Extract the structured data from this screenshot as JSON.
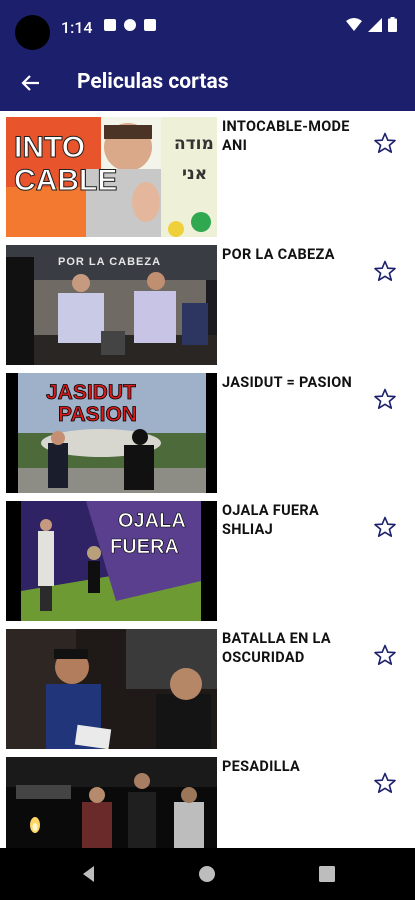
{
  "status_bar": {
    "time": "1:14"
  },
  "app_bar": {
    "title": "Peliculas cortas",
    "back_icon": "arrow-back-icon"
  },
  "items": [
    {
      "title": "INTOCABLE-MODE ANI",
      "thumb_lines": [
        "INTO",
        "CABLE"
      ],
      "thumb_hebrew": [
        "מודה",
        "אני"
      ]
    },
    {
      "title": "POR LA CABEZA",
      "thumb_lines": [
        "POR LA CABEZA"
      ]
    },
    {
      "title": "JASIDUT = PASION",
      "thumb_lines": [
        "JASIDUT",
        "PASION"
      ]
    },
    {
      "title": "OJALA FUERA SHLIAJ",
      "thumb_lines": [
        "OJALA",
        "FUERA"
      ]
    },
    {
      "title": "BATALLA EN LA OSCURIDAD",
      "thumb_lines": []
    },
    {
      "title": "PESADILLA",
      "thumb_lines": []
    }
  ],
  "colors": {
    "brand": "#1c1f6b",
    "star": "#1c1f6b"
  }
}
